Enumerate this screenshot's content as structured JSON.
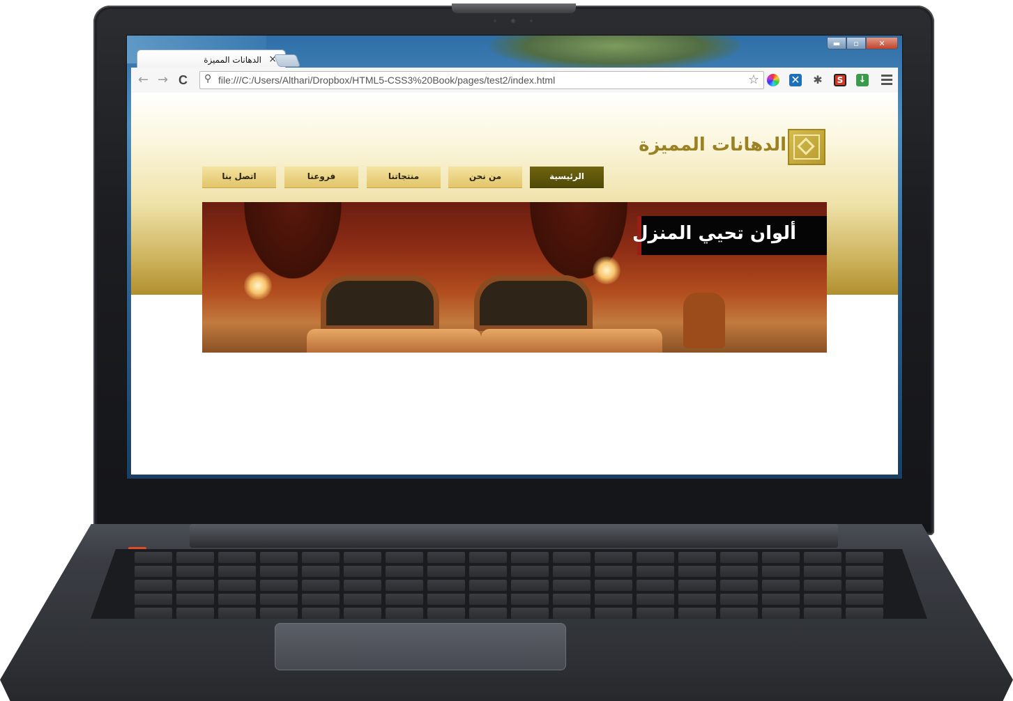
{
  "browser": {
    "tab_title": "الدهانات المميزة",
    "tab_close": "×",
    "url": "file:///C:/Users/Althari/Dropbox/HTML5-CSS3%20Book/pages/test2/index.html",
    "back_icon": "←",
    "forward_icon": "→",
    "reload_icon": "C",
    "window_controls": {
      "minimize": "▬",
      "maximize": "▫",
      "close": "✕"
    }
  },
  "site": {
    "logo_text": "الدهانات المميزة",
    "nav": [
      {
        "label": "الرئيسية",
        "active": true
      },
      {
        "label": "من نحن",
        "active": false
      },
      {
        "label": "منتجاتنا",
        "active": false
      },
      {
        "label": "فروعنا",
        "active": false
      },
      {
        "label": "اتصل بنا",
        "active": false
      }
    ],
    "hero_caption": "ألوان تحيي المنزل"
  },
  "colors": {
    "nav_active": "#5e560c",
    "nav_item": "#e8cf7f",
    "logo_gold": "#9c8122",
    "hero_caption_bg": "#050505"
  },
  "icons": [
    "back-arrow-icon",
    "forward-arrow-icon",
    "reload-icon",
    "search-icon",
    "bookmark-star-icon",
    "color-picker-extension-icon",
    "x-extension-icon",
    "bug-extension-icon",
    "s-extension-icon",
    "download-extension-icon",
    "menu-icon",
    "logo-emblem-icon"
  ]
}
